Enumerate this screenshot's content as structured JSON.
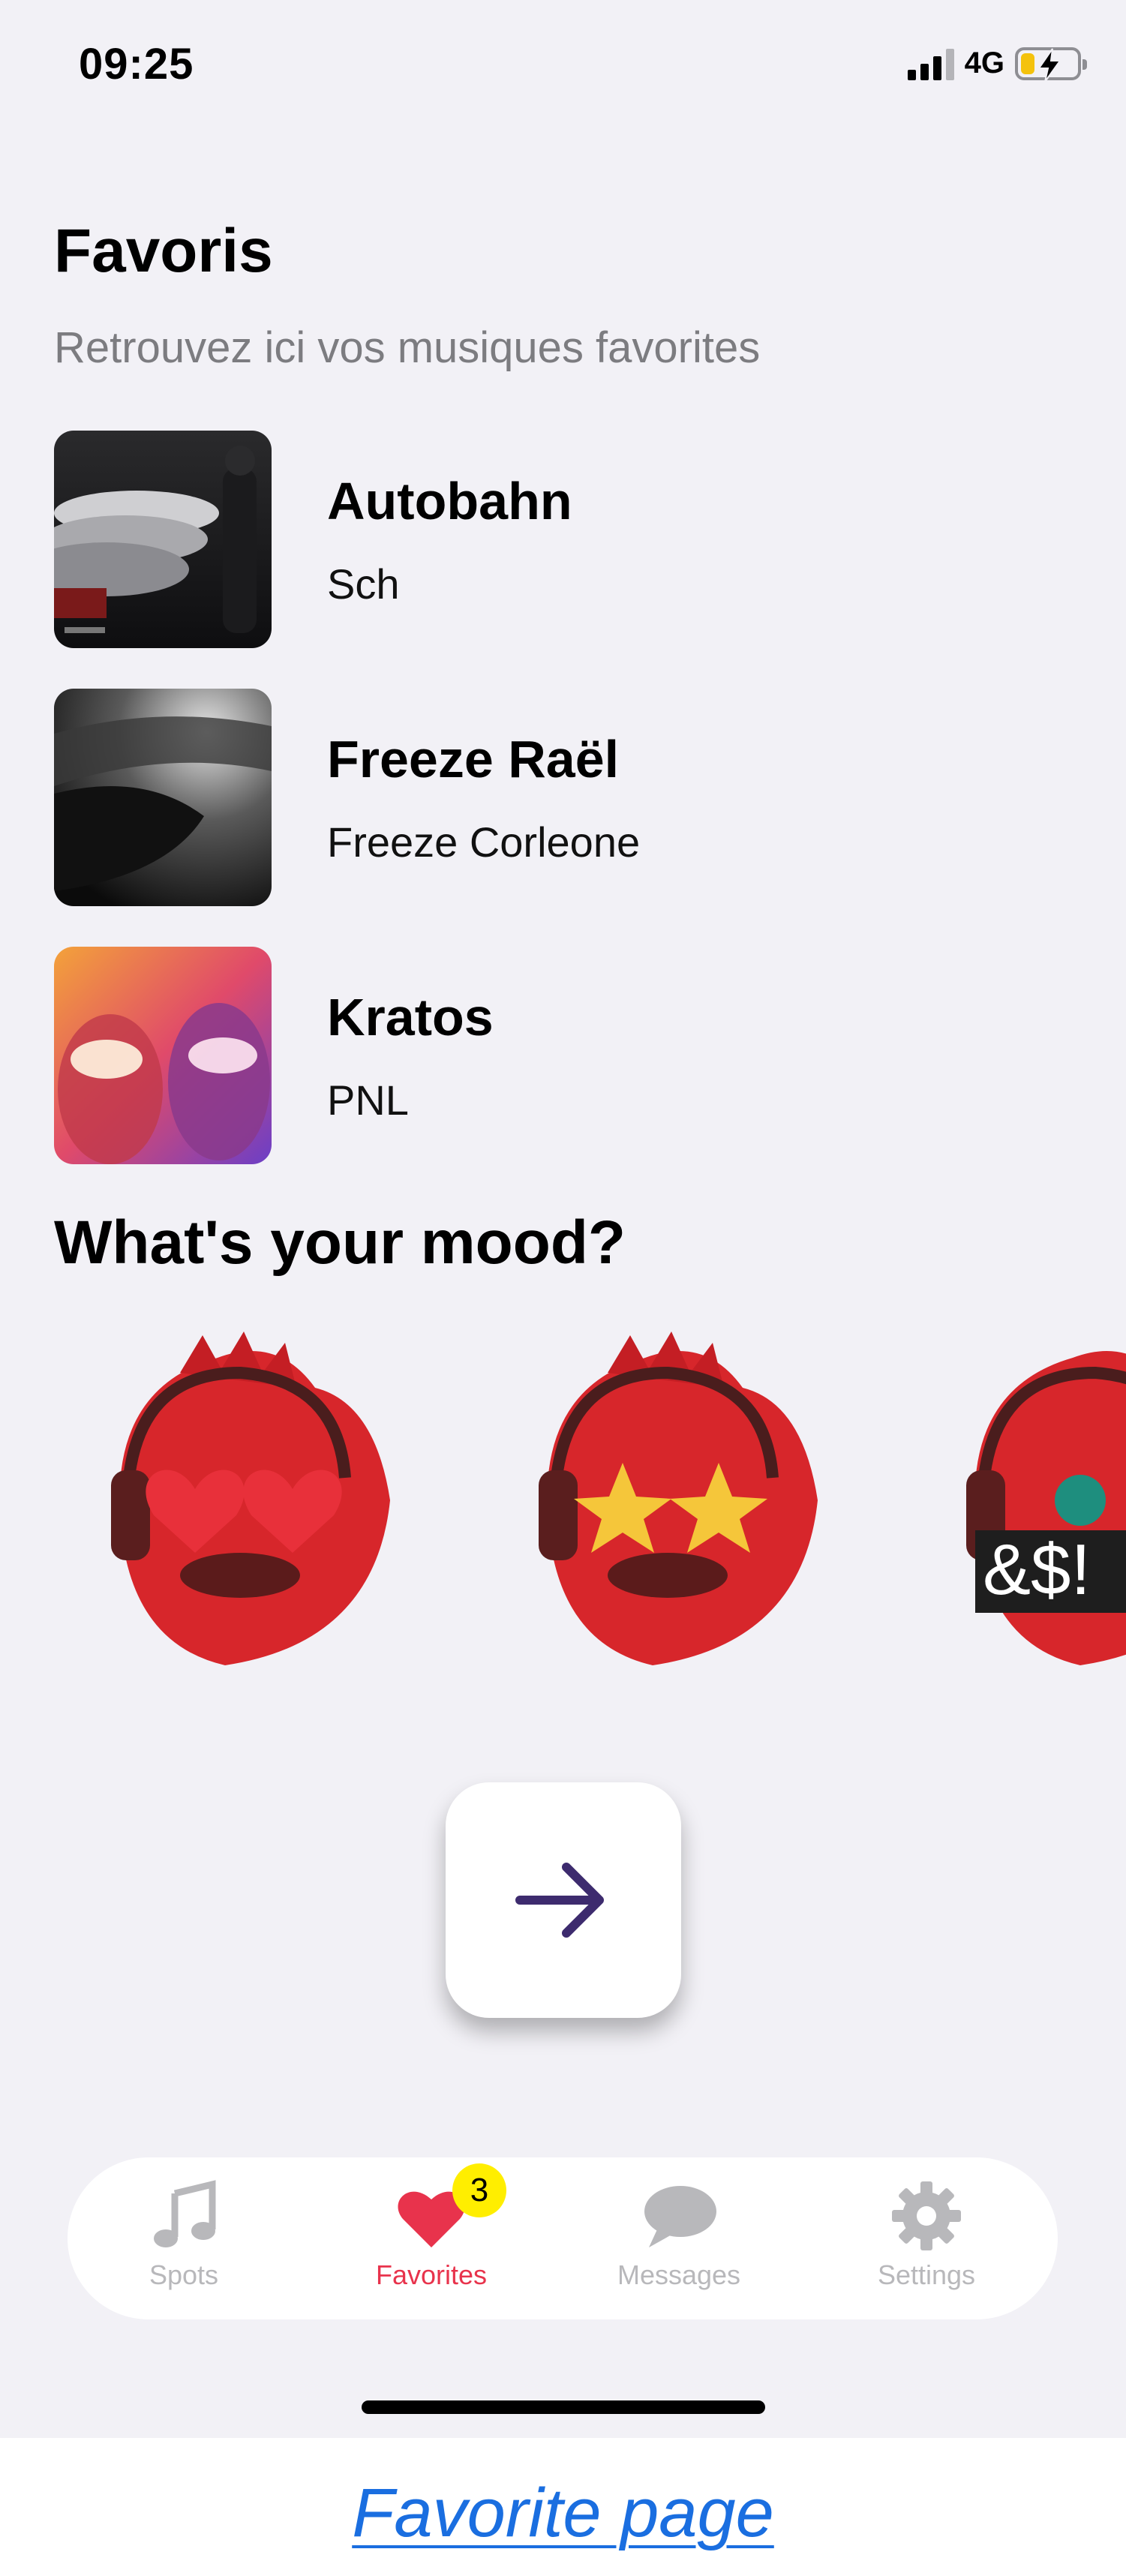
{
  "status_bar": {
    "time": "09:25",
    "network": "4G",
    "battery_level": 0.32
  },
  "page": {
    "title": "Favoris",
    "subtitle": "Retrouvez ici vos musiques favorites"
  },
  "favorites": [
    {
      "title": "Autobahn",
      "artist": "Sch"
    },
    {
      "title": "Freeze Raël",
      "artist": "Freeze Corleone"
    },
    {
      "title": "Kratos",
      "artist": "PNL"
    }
  ],
  "mood": {
    "title": "What's your mood?",
    "options": [
      {
        "icon": "heart-eyes-bird-emoji"
      },
      {
        "icon": "star-eyes-bird-emoji"
      },
      {
        "icon": "angry-swearing-bird-emoji",
        "text": "&$!"
      }
    ]
  },
  "next_button": {
    "icon": "arrow-right-icon",
    "color": "#3d2b6e"
  },
  "tab_bar": {
    "tabs": [
      {
        "label": "Spots",
        "icon": "music-note-icon"
      },
      {
        "label": "Favorites",
        "icon": "heart-icon",
        "badge": "3",
        "active": true
      },
      {
        "label": "Messages",
        "icon": "chat-bubble-icon"
      },
      {
        "label": "Settings",
        "icon": "gear-icon"
      }
    ],
    "active_color": "#e8334c",
    "inactive_color": "#b8b8bb"
  },
  "caption": {
    "text": "Favorite page"
  }
}
